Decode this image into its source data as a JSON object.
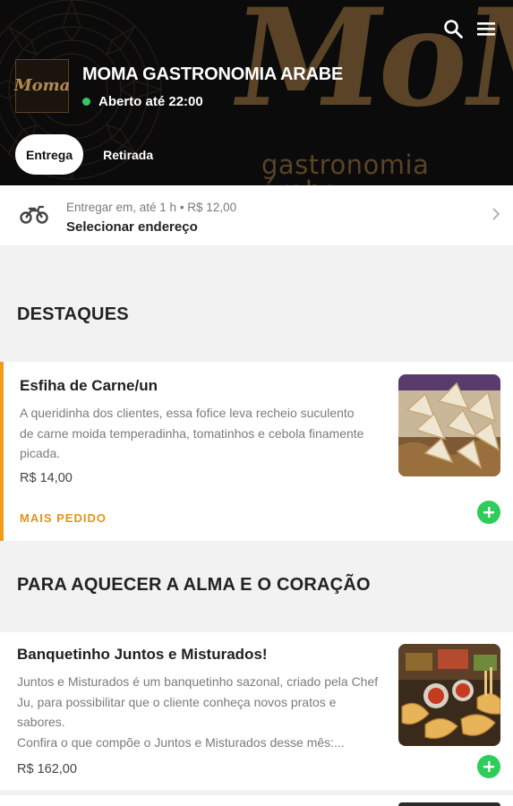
{
  "header": {
    "restaurant_name": "MOMA GASTRONOMIA ARABE",
    "status_text": "Aberto até 22:00",
    "brand_watermark": "MoMA",
    "brand_tagline": "gastronomia árabe",
    "logo_text": "Moma",
    "tabs": [
      {
        "label": "Entrega",
        "active": true
      },
      {
        "label": "Retirada",
        "active": false
      }
    ],
    "icons": [
      "search-icon",
      "menu-icon"
    ]
  },
  "delivery": {
    "info": "Entregar em, até 1 h  •  R$ 12,00",
    "action_label": "Selecionar endereço",
    "icon": "motorcycle-icon"
  },
  "sections": [
    {
      "title": "DESTAQUES",
      "items": [
        {
          "name": "Esfiha de Carne/un",
          "description": "A queridinha dos clientes, essa fofice leva recheio suculento de carne moida temperadinha, tomatinhos e cebola finamente picada.",
          "price": "R$ 14,00",
          "tag": "MAIS PEDIDO"
        }
      ]
    },
    {
      "title": "PARA AQUECER A ALMA E O CORAÇÃO",
      "items": [
        {
          "name": "Banquetinho Juntos e Misturados!",
          "description": "Juntos e Misturados é um banquetinho sazonal, criado pela Chef Ju, para possibilitar que o cliente conheça novos pratos e sabores.",
          "description_2": "Confira o que compõe o Juntos e Misturados desse mês:...",
          "price": "R$ 162,00"
        }
      ]
    }
  ],
  "colors": {
    "header_bg": "#0b0b0b",
    "brand_gold": "#5a4326",
    "accent_orange": "#f29a1c",
    "add_green": "#2ecc58",
    "status_green": "#39c46a"
  }
}
